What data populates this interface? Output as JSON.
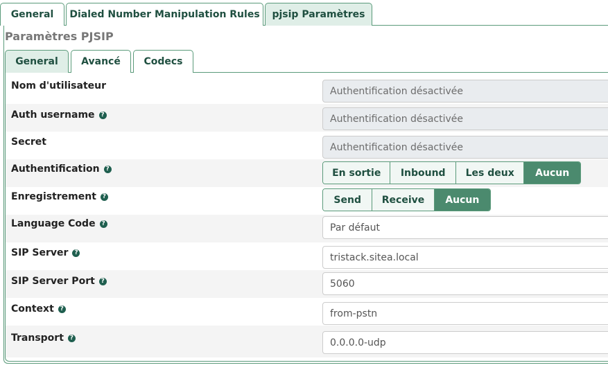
{
  "top_tabs": [
    "General",
    "Dialed Number Manipulation Rules",
    "pjsip Paramètres"
  ],
  "section_title": "Paramètres PJSIP",
  "sub_tabs": [
    "General",
    "Avancé",
    "Codecs"
  ],
  "help_glyph": "?",
  "fields": {
    "nom_utilisateur": {
      "label": "Nom d'utilisateur",
      "value": "Authentification désactivée"
    },
    "auth_username": {
      "label": "Auth username",
      "value": "Authentification désactivée"
    },
    "secret": {
      "label": "Secret",
      "value": "Authentification désactivée"
    },
    "authentification": {
      "label": "Authentification",
      "options": [
        "En sortie",
        "Inbound",
        "Les deux",
        "Aucun"
      ],
      "selected": "Aucun"
    },
    "enregistrement": {
      "label": "Enregistrement",
      "options": [
        "Send",
        "Receive",
        "Aucun"
      ],
      "selected": "Aucun"
    },
    "language_code": {
      "label": "Language Code",
      "value": "Par défaut"
    },
    "sip_server": {
      "label": "SIP Server",
      "value": "tristack.sitea.local"
    },
    "sip_server_port": {
      "label": "SIP Server Port",
      "value": "5060"
    },
    "context": {
      "label": "Context",
      "value": "from-pstn"
    },
    "transport": {
      "label": "Transport",
      "value": "0.0.0.0-udp"
    }
  },
  "colors": {
    "accent": "#4b8a6e",
    "border": "#5a9a7a",
    "tab_active_bg": "#dfeee7",
    "disabled_bg": "#e9ecef"
  }
}
